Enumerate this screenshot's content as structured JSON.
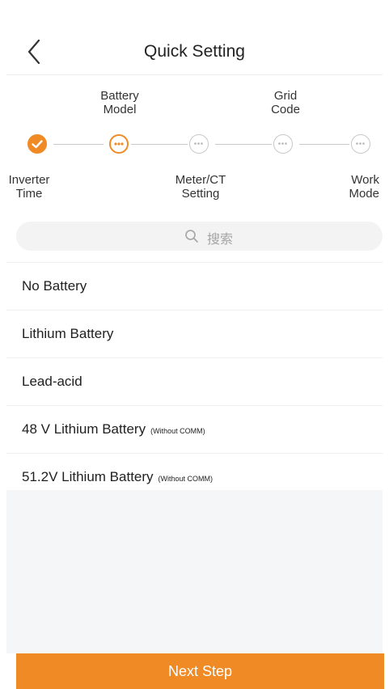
{
  "header": {
    "title": "Quick Setting",
    "back_icon": "chevron-left-icon"
  },
  "steps": {
    "top_labels": [
      "Battery\nModel",
      "Grid\nCode"
    ],
    "bottom_labels": [
      "Inverter\nTime",
      "Meter/CT\nSetting",
      "Work\nMode"
    ],
    "items": [
      {
        "state": "done"
      },
      {
        "state": "current"
      },
      {
        "state": "pending"
      },
      {
        "state": "pending"
      },
      {
        "state": "pending"
      }
    ],
    "colors": {
      "accent": "#f08a24",
      "pending": "#c8c8c8"
    }
  },
  "search": {
    "placeholder": "搜索",
    "icon": "search-icon"
  },
  "battery_options": [
    {
      "label": "No Battery",
      "note": ""
    },
    {
      "label": "Lithium Battery",
      "note": ""
    },
    {
      "label": "Lead-acid",
      "note": ""
    },
    {
      "label": "48 V Lithium Battery",
      "note": "(Without COMM)"
    },
    {
      "label": "51.2V Lithium Battery",
      "note": "(Without COMM)"
    }
  ],
  "footer": {
    "next_label": "Next Step"
  }
}
